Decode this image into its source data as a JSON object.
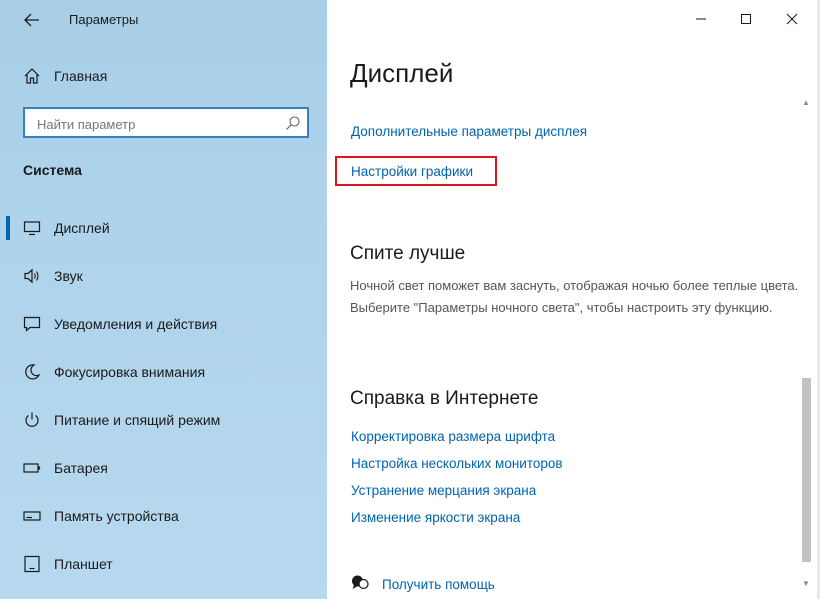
{
  "window": {
    "app_title": "Параметры",
    "accent_color": "#0063b1",
    "highlight_color": "#e0161e"
  },
  "sidebar": {
    "home_label": "Главная",
    "search_placeholder": "Найти параметр",
    "section_label": "Система",
    "items": [
      {
        "label": "Дисплей",
        "icon": "monitor-icon",
        "active": true
      },
      {
        "label": "Звук",
        "icon": "speaker-icon"
      },
      {
        "label": "Уведомления и действия",
        "icon": "notification-icon"
      },
      {
        "label": "Фокусировка внимания",
        "icon": "moon-icon"
      },
      {
        "label": "Питание и спящий режим",
        "icon": "power-icon"
      },
      {
        "label": "Батарея",
        "icon": "battery-icon"
      },
      {
        "label": "Память устройства",
        "icon": "storage-icon"
      },
      {
        "label": "Планшет",
        "icon": "tablet-icon"
      }
    ]
  },
  "main": {
    "page_title": "Дисплей",
    "links_top": [
      "Дополнительные параметры дисплея",
      "Настройки графики"
    ],
    "sleep_section": {
      "heading": "Спите лучше",
      "description": "Ночной свет поможет вам заснуть, отображая ночью более теплые цвета. Выберите \"Параметры ночного света\", чтобы настроить эту функцию."
    },
    "help_section": {
      "heading": "Справка в Интернете",
      "links": [
        "Корректировка размера шрифта",
        "Настройка нескольких мониторов",
        "Устранение мерцания экрана",
        "Изменение яркости экрана"
      ]
    },
    "get_help_label": "Получить помощь"
  }
}
